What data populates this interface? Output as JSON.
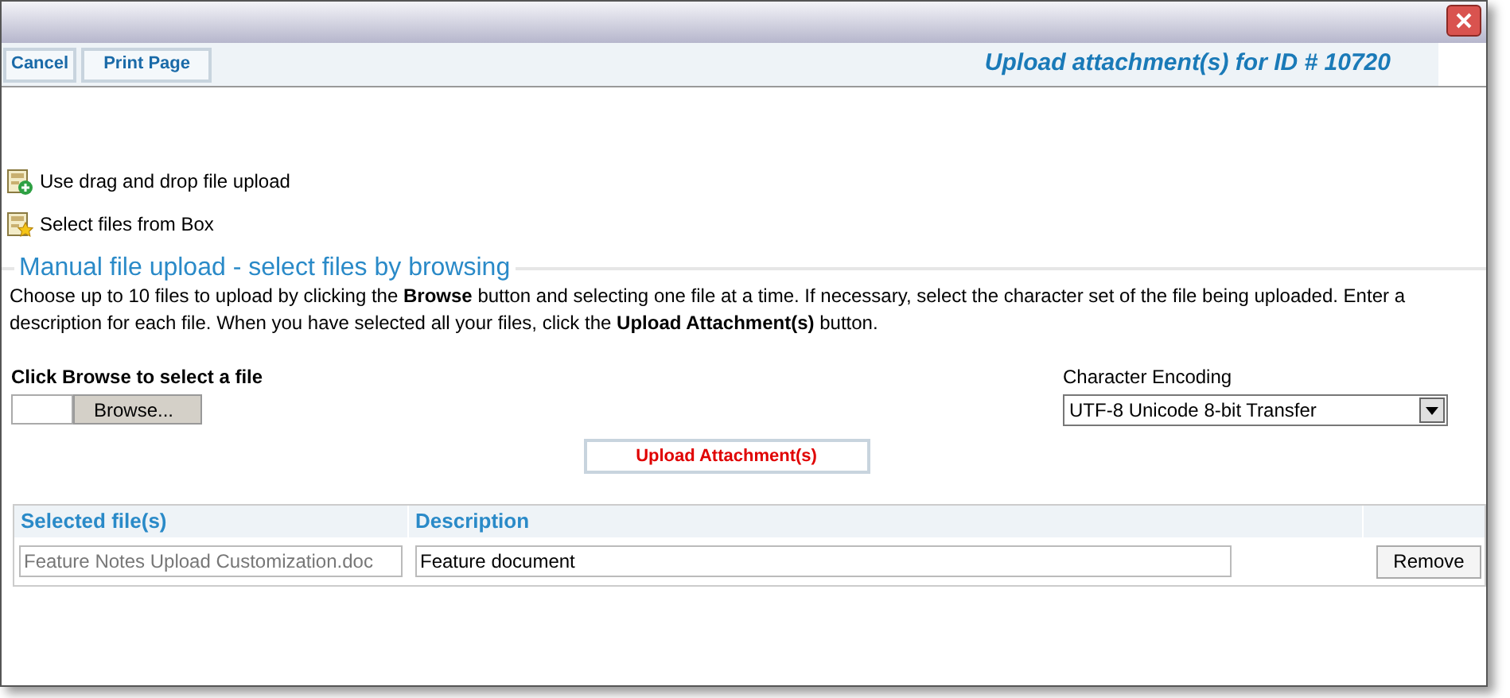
{
  "toolbar": {
    "buttons": [
      "Cancel",
      "Print Page"
    ],
    "title": "Upload attachment(s) for ID # 10720"
  },
  "links": [
    {
      "kind": "drag",
      "label": "Use drag and drop file upload"
    },
    {
      "kind": "box",
      "label": "Select files from Box"
    }
  ],
  "manual": {
    "legend": "Manual file upload - select files by browsing",
    "instructions": "Choose up to 10 files to upload by clicking the **Browse** button and selecting one file at a time. If necessary, select the character set of the file being uploaded. Enter a description for each file. When you have selected all your files, click the **Upload Attachment(s)** button.",
    "file_label": "Click Browse to select a file",
    "browse_button": "Browse...",
    "encoding_label": "Character Encoding",
    "encoding_value": "UTF-8 Unicode 8-bit Transfer",
    "upload_button": "Upload Attachment(s)"
  },
  "table": {
    "columns": [
      "Selected file(s)",
      "Description"
    ],
    "rows": [
      {
        "file": "Feature Notes Upload Customization.doc",
        "description": "Feature document",
        "remove": "Remove"
      }
    ]
  }
}
